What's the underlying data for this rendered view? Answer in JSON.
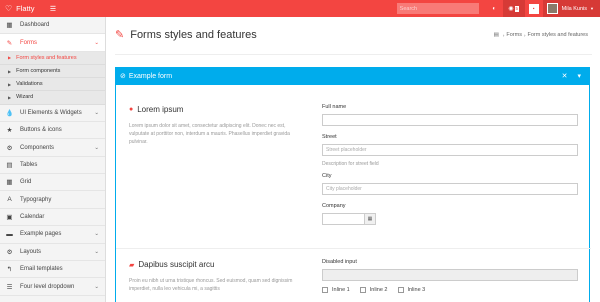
{
  "topbar": {
    "brand": "Flatty",
    "search_placeholder": "Search",
    "rss_badge": "5",
    "user_name": "Mila Kunis"
  },
  "sidebar": {
    "items": [
      {
        "label": "Dashboard",
        "icon": "dashboard-icon",
        "glyph": "▦"
      },
      {
        "label": "Forms",
        "icon": "edit-icon",
        "glyph": "✎"
      }
    ],
    "sub_items": [
      {
        "label": "Form styles and features"
      },
      {
        "label": "Form components"
      },
      {
        "label": "Validations"
      },
      {
        "label": "Wizard"
      }
    ],
    "more_items": [
      {
        "label": "UI Elements & Widgets",
        "icon": "tint-icon",
        "glyph": "💧",
        "chevron": true
      },
      {
        "label": "Buttons & icons",
        "icon": "star-icon",
        "glyph": "★",
        "chevron": false
      },
      {
        "label": "Components",
        "icon": "cogs-icon",
        "glyph": "⚙",
        "chevron": true
      },
      {
        "label": "Tables",
        "icon": "table-icon",
        "glyph": "▤",
        "chevron": false
      },
      {
        "label": "Grid",
        "icon": "grid-icon",
        "glyph": "▦",
        "chevron": false
      },
      {
        "label": "Typography",
        "icon": "typography-icon",
        "glyph": "A",
        "chevron": false
      },
      {
        "label": "Calendar",
        "icon": "calendar-icon",
        "glyph": "▣",
        "chevron": false
      },
      {
        "label": "Example pages",
        "icon": "folder-icon",
        "glyph": "▬",
        "chevron": true
      },
      {
        "label": "Layouts",
        "icon": "layouts-icon",
        "glyph": "⚙",
        "chevron": true
      },
      {
        "label": "Email templates",
        "icon": "reply-icon",
        "glyph": "↰",
        "chevron": false
      },
      {
        "label": "Four level dropdown",
        "icon": "list-icon",
        "glyph": "☰",
        "chevron": true
      }
    ]
  },
  "main": {
    "title": "Forms styles and features",
    "breadcrumb": [
      "Forms",
      "Form styles and features"
    ],
    "box_title": "Example form",
    "section1": {
      "title": "Lorem ipsum",
      "desc": "Lorem ipsum dolor sit amet, consectetur adipiscing elit. Donec nec est, vulputate at porttitor non, interdum a mauris. Phasellus imperdiet gravida pulvinar."
    },
    "section2": {
      "title": "Dapibus suscipit arcu",
      "desc": "Proin eu nibh ut urna tristique rhoncus. Sed euismod, quam sed dignissim imperdiet, nulla leo vehicula mi, a sagittis"
    },
    "fields": {
      "full_name_label": "Full name",
      "street_label": "Street",
      "street_placeholder": "Street placeholder",
      "street_help": "Description for street field",
      "city_label": "City",
      "city_placeholder": "City placeholder",
      "company_label": "Company",
      "disabled_label": "Disabled input",
      "checks": [
        "Inline 1",
        "Inline 2",
        "Inline 3"
      ]
    }
  },
  "colors": {
    "accent": "#f34541",
    "box_header": "#00acec"
  }
}
